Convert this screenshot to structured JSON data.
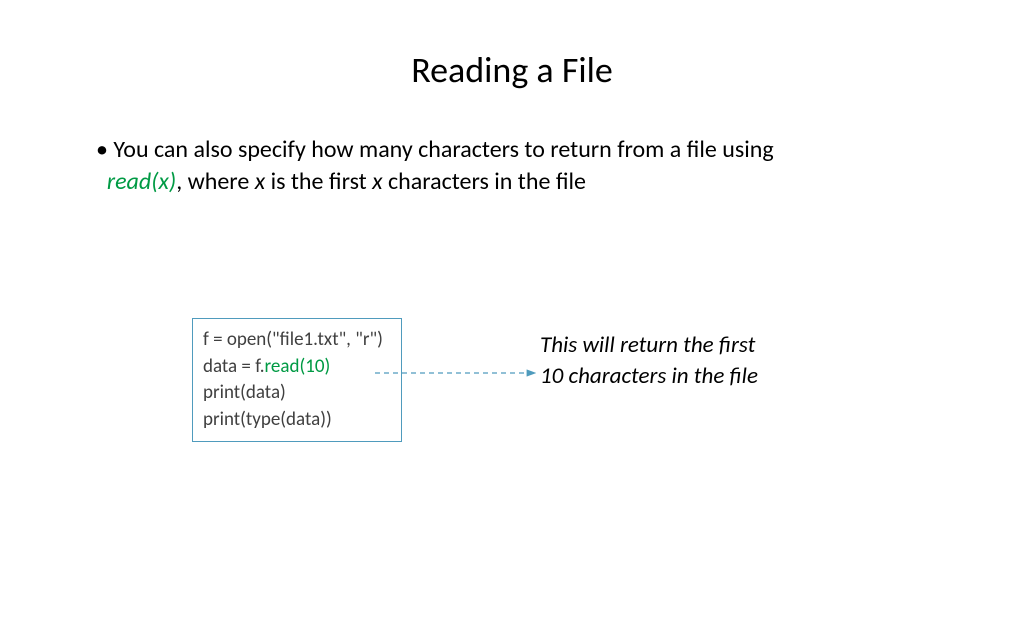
{
  "title": "Reading a File",
  "bullet": {
    "text_before": "You can also specify how many characters to return from a file using ",
    "code_func": "read(x)",
    "text_mid1": ", where ",
    "var1": "x",
    "text_mid2": " is the first ",
    "var2": "x",
    "text_after": " characters in the file"
  },
  "code": {
    "line1": "f = open(\"file1.txt\", \"r\")",
    "line2_pre": "data = f.",
    "line2_func": "read(10)",
    "line3": "print(data)",
    "line4": "print(type(data))"
  },
  "annotation": {
    "line1": "This will return the first",
    "line2": "10 characters in the file"
  },
  "colors": {
    "accent_green": "#009a44",
    "box_border": "#4f9bbd",
    "arrow": "#4f9bbd"
  }
}
